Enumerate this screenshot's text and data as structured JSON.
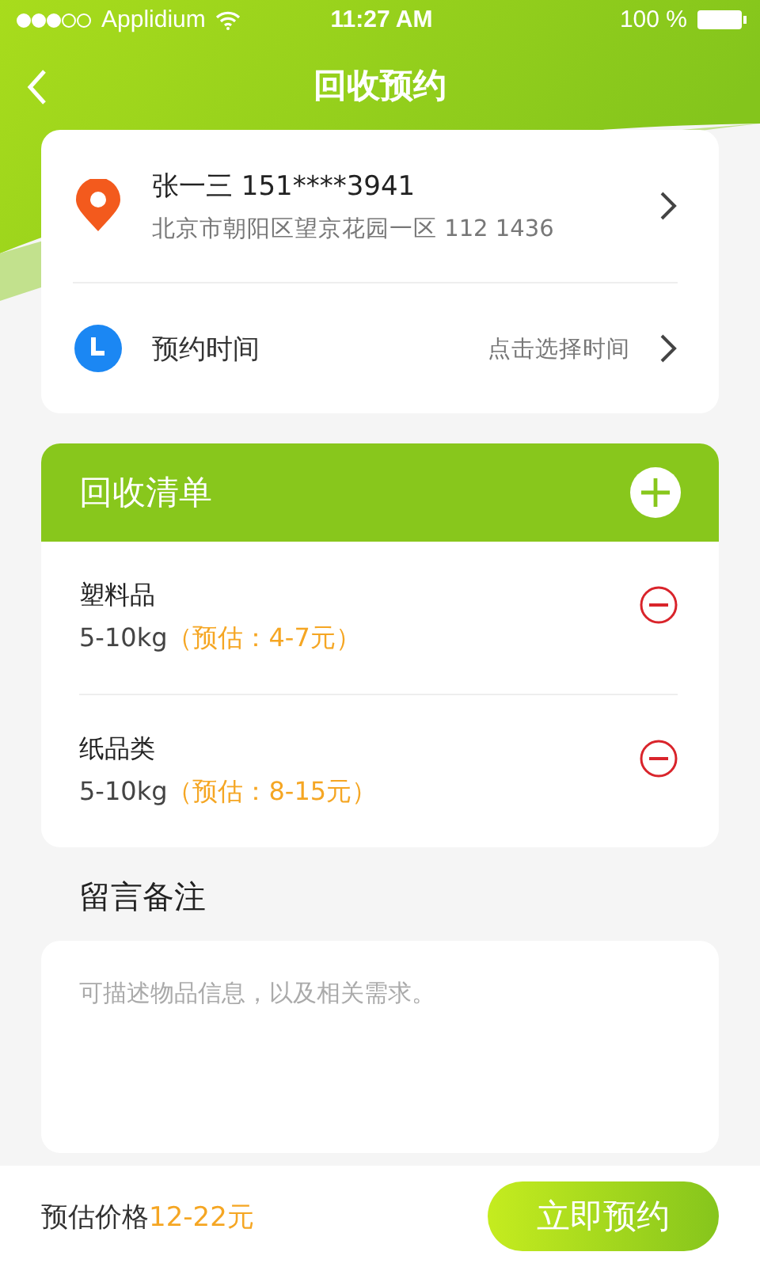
{
  "status_bar": {
    "carrier": "Applidium",
    "time": "11:27 AM",
    "battery": "100 %"
  },
  "nav": {
    "title": "回收预约"
  },
  "address": {
    "name_phone": "张一三 151****3941",
    "address": "北京市朝阳区望京花园一区 112 1436"
  },
  "appointment": {
    "label": "预约时间",
    "value": "点击选择时间"
  },
  "recycle_list": {
    "title": "回收清单",
    "items": [
      {
        "name": "塑料品",
        "weight": "5-10kg",
        "estimate": "（预估：4-7元）"
      },
      {
        "name": "纸品类",
        "weight": "5-10kg",
        "estimate": "（预估：8-15元）"
      }
    ]
  },
  "notes": {
    "title": "留言备注",
    "placeholder": "可描述物品信息，以及相关需求。"
  },
  "footer": {
    "price_label": "预估价格",
    "price": "12-22元",
    "button": "立即预约"
  }
}
